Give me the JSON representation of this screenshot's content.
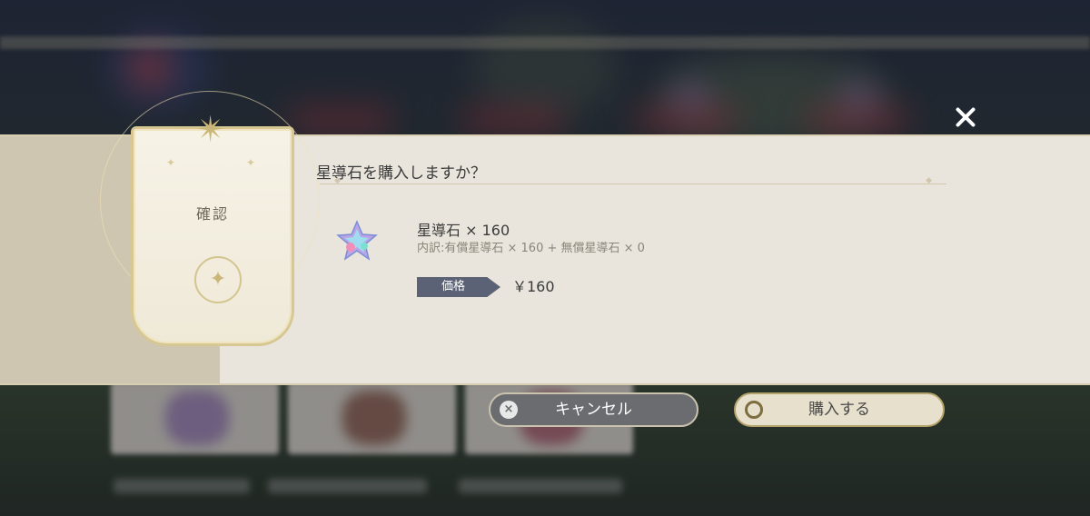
{
  "dialog": {
    "emblem_title": "確認",
    "question": "星導石を購入しますか？",
    "item": {
      "icon": "star-stone-icon",
      "name": "星導石 × 160",
      "breakdown": "内訳:有償星導石 × 160 + 無償星導石 × 0"
    },
    "price": {
      "label": "価格",
      "value": "￥160"
    }
  },
  "buttons": {
    "cancel_icon": "×",
    "cancel_label": "キャンセル",
    "buy_label": "購入する"
  },
  "colors": {
    "panel_bg": "#e9e5dc",
    "accent_gold": "#b3a26a",
    "price_tag": "#5b6275",
    "cancel_button": "#6a6c70"
  }
}
